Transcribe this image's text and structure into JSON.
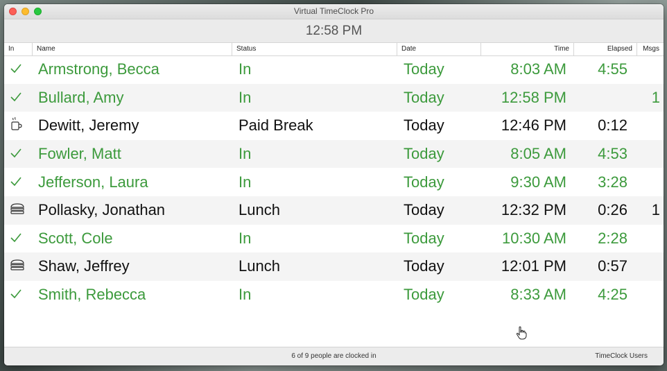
{
  "window": {
    "title": "Virtual TimeClock Pro"
  },
  "clock": "12:58 PM",
  "columns": {
    "in": "In",
    "name": "Name",
    "status": "Status",
    "date": "Date",
    "time": "Time",
    "elapsed": "Elapsed",
    "msgs": "Msgs"
  },
  "rows": [
    {
      "icon": "checkmark-icon",
      "name": "Armstrong, Becca",
      "status": "In",
      "date": "Today",
      "time": "8:03 AM",
      "elapsed": "4:55",
      "msgs": ""
    },
    {
      "icon": "checkmark-icon",
      "name": "Bullard, Amy",
      "status": "In",
      "date": "Today",
      "time": "12:58 PM",
      "elapsed": "",
      "msgs": "1"
    },
    {
      "icon": "coffee-cup-icon",
      "name": "Dewitt, Jeremy",
      "status": "Paid Break",
      "date": "Today",
      "time": "12:46 PM",
      "elapsed": "0:12",
      "msgs": ""
    },
    {
      "icon": "checkmark-icon",
      "name": "Fowler, Matt",
      "status": "In",
      "date": "Today",
      "time": "8:05 AM",
      "elapsed": "4:53",
      "msgs": ""
    },
    {
      "icon": "checkmark-icon",
      "name": "Jefferson, Laura",
      "status": "In",
      "date": "Today",
      "time": "9:30 AM",
      "elapsed": "3:28",
      "msgs": ""
    },
    {
      "icon": "sandwich-icon",
      "name": "Pollasky, Jonathan",
      "status": "Lunch",
      "date": "Today",
      "time": "12:32 PM",
      "elapsed": "0:26",
      "msgs": "1"
    },
    {
      "icon": "checkmark-icon",
      "name": "Scott, Cole",
      "status": "In",
      "date": "Today",
      "time": "10:30 AM",
      "elapsed": "2:28",
      "msgs": ""
    },
    {
      "icon": "sandwich-icon",
      "name": "Shaw, Jeffrey",
      "status": "Lunch",
      "date": "Today",
      "time": "12:01 PM",
      "elapsed": "0:57",
      "msgs": ""
    },
    {
      "icon": "checkmark-icon",
      "name": "Smith, Rebecca",
      "status": "In",
      "date": "Today",
      "time": "8:33 AM",
      "elapsed": "4:25",
      "msgs": ""
    }
  ],
  "footer": {
    "status": "6 of 9 people are clocked in",
    "users": "TimeClock Users"
  },
  "colors": {
    "in_green": "#3c9a3c",
    "text_black": "#111111"
  }
}
